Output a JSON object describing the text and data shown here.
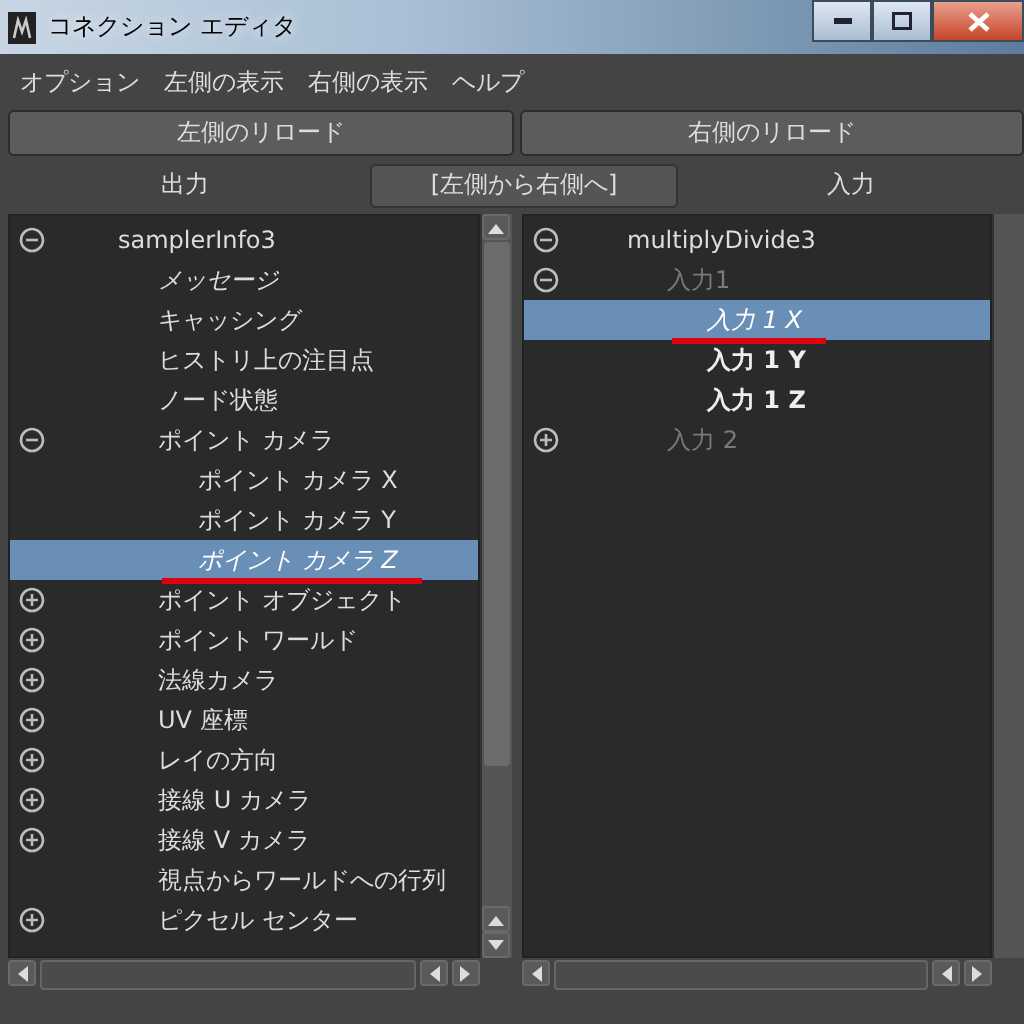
{
  "window": {
    "title": "コネクション エディタ"
  },
  "menu": [
    "オプション",
    "左側の表示",
    "右側の表示",
    "ヘルプ"
  ],
  "reload_buttons": [
    "左側のリロード",
    "右側のリロード"
  ],
  "header": {
    "left": "出力",
    "direction_button": "[左側から右側へ]",
    "right": "入力"
  },
  "left_tree": [
    {
      "label": "samplerInfo3",
      "expanded": true,
      "selected": false,
      "children": [
        {
          "label": "メッセージ",
          "kind": "connected",
          "selected": false
        },
        {
          "label": "キャッシング",
          "kind": "normal",
          "selected": false
        },
        {
          "label": "ヒストリ上の注目点",
          "kind": "normal",
          "selected": false
        },
        {
          "label": "ノード状態",
          "kind": "normal",
          "selected": false
        },
        {
          "label": "ポイント カメラ",
          "kind": "normal",
          "expanded": true,
          "selected": false,
          "children": [
            {
              "label": "ポイント カメラ X",
              "kind": "normal",
              "selected": false
            },
            {
              "label": "ポイント カメラ Y",
              "kind": "normal",
              "selected": false
            },
            {
              "label": "ポイント カメラ Z",
              "kind": "connected",
              "selected": true,
              "marked": true
            }
          ]
        },
        {
          "label": "ポイント オブジェクト",
          "kind": "normal",
          "expanded": false,
          "selected": false
        },
        {
          "label": "ポイント ワールド",
          "kind": "normal",
          "expanded": false,
          "selected": false
        },
        {
          "label": "法線カメラ",
          "kind": "normal",
          "expanded": false,
          "selected": false
        },
        {
          "label": "UV 座標",
          "kind": "normal",
          "expanded": false,
          "selected": false
        },
        {
          "label": "レイの方向",
          "kind": "normal",
          "expanded": false,
          "selected": false
        },
        {
          "label": "接線 U カメラ",
          "kind": "normal",
          "expanded": false,
          "selected": false
        },
        {
          "label": "接線 V カメラ",
          "kind": "normal",
          "expanded": false,
          "selected": false
        },
        {
          "label": "視点からワールドへの行列",
          "kind": "normal",
          "selected": false
        },
        {
          "label": "ピクセル センター",
          "kind": "normal",
          "expanded": false,
          "selected": false
        }
      ]
    }
  ],
  "right_tree": [
    {
      "label": "multiplyDivide3",
      "expanded": true,
      "selected": false,
      "children": [
        {
          "label": "入力1",
          "kind": "disabled",
          "expanded": true,
          "selected": false,
          "children": [
            {
              "label": "入力 1 X",
              "kind": "connected",
              "selected": true,
              "marked": true
            },
            {
              "label": "入力 1 Y",
              "kind": "keyable",
              "selected": false
            },
            {
              "label": "入力 1 Z",
              "kind": "keyable",
              "selected": false
            }
          ]
        },
        {
          "label": "入力 2",
          "kind": "disabled",
          "expanded": false,
          "selected": false
        }
      ]
    }
  ]
}
